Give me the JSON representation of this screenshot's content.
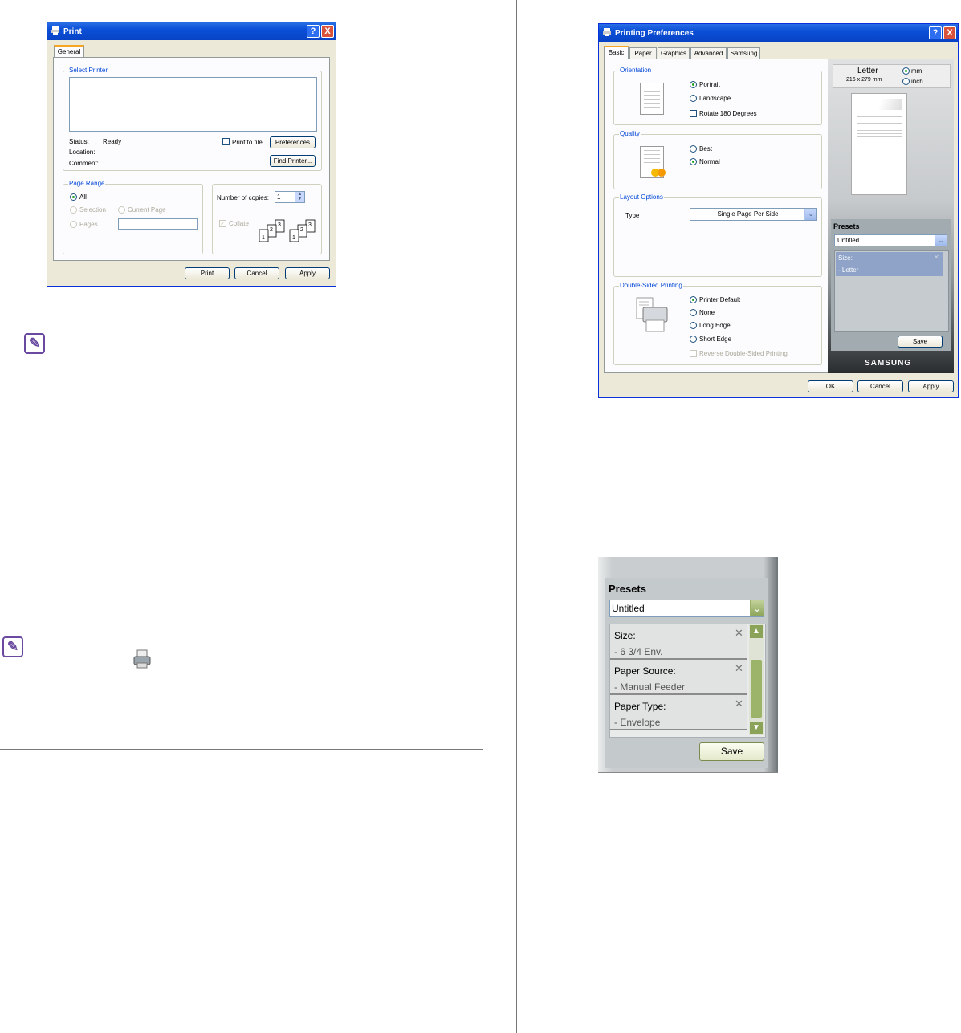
{
  "print_dialog": {
    "title": "Print",
    "help_btn": "?",
    "close_btn": "X",
    "tab_general": "General",
    "select_printer_label": "Select Printer",
    "status_label": "Status:",
    "status_value": "Ready",
    "location_label": "Location:",
    "comment_label": "Comment:",
    "print_to_file": "Print to file",
    "preferences_btn": "Preferences",
    "find_printer_btn": "Find Printer...",
    "page_range_label": "Page Range",
    "all_label": "All",
    "selection_label": "Selection",
    "current_page_label": "Current Page",
    "pages_label": "Pages",
    "copies_label": "Number of copies:",
    "copies_value": "1",
    "collate_label": "Collate",
    "print_btn": "Print",
    "cancel_btn": "Cancel",
    "apply_btn": "Apply"
  },
  "prefs_dialog": {
    "title": "Printing Preferences",
    "help_btn": "?",
    "close_btn": "X",
    "tabs": [
      "Basic",
      "Paper",
      "Graphics",
      "Advanced",
      "Samsung"
    ],
    "orientation_label": "Orientation",
    "portrait": "Portrait",
    "landscape": "Landscape",
    "rotate": "Rotate 180 Degrees",
    "quality_label": "Quality",
    "best": "Best",
    "normal": "Normal",
    "layout_label": "Layout Options",
    "type_label": "Type",
    "type_value": "Single Page Per Side",
    "duplex_label": "Double-Sided Printing",
    "printer_default": "Printer Default",
    "none": "None",
    "long_edge": "Long Edge",
    "short_edge": "Short Edge",
    "reverse_duplex": "Reverse Double-Sided Printing",
    "paper_name": "Letter",
    "paper_size": "216 x 279 mm",
    "unit_mm": "mm",
    "unit_inch": "inch",
    "presets_label": "Presets",
    "preset_value": "Untitled",
    "preset_size_label": "Size:",
    "preset_size_value": "- Letter",
    "save_btn": "Save",
    "brand": "SAMSUNG",
    "ok_btn": "OK",
    "cancel_btn": "Cancel",
    "apply_btn": "Apply"
  },
  "presets_zoom": {
    "title": "Presets",
    "value": "Untitled",
    "items": [
      {
        "label": "Size:",
        "value": "- 6 3/4 Env."
      },
      {
        "label": "Paper Source:",
        "value": "- Manual Feeder"
      },
      {
        "label": "Paper Type:",
        "value": "- Envelope"
      }
    ],
    "remove_glyph": "✕",
    "save_btn": "Save"
  },
  "note_glyph": "✎",
  "colors": {
    "xp_title": "#0a4fd6",
    "xp_face": "#ece9d8",
    "group_label": "#0046d5",
    "presets_bg": "#9aa5a8",
    "note_icon": "#6a4aa1"
  }
}
